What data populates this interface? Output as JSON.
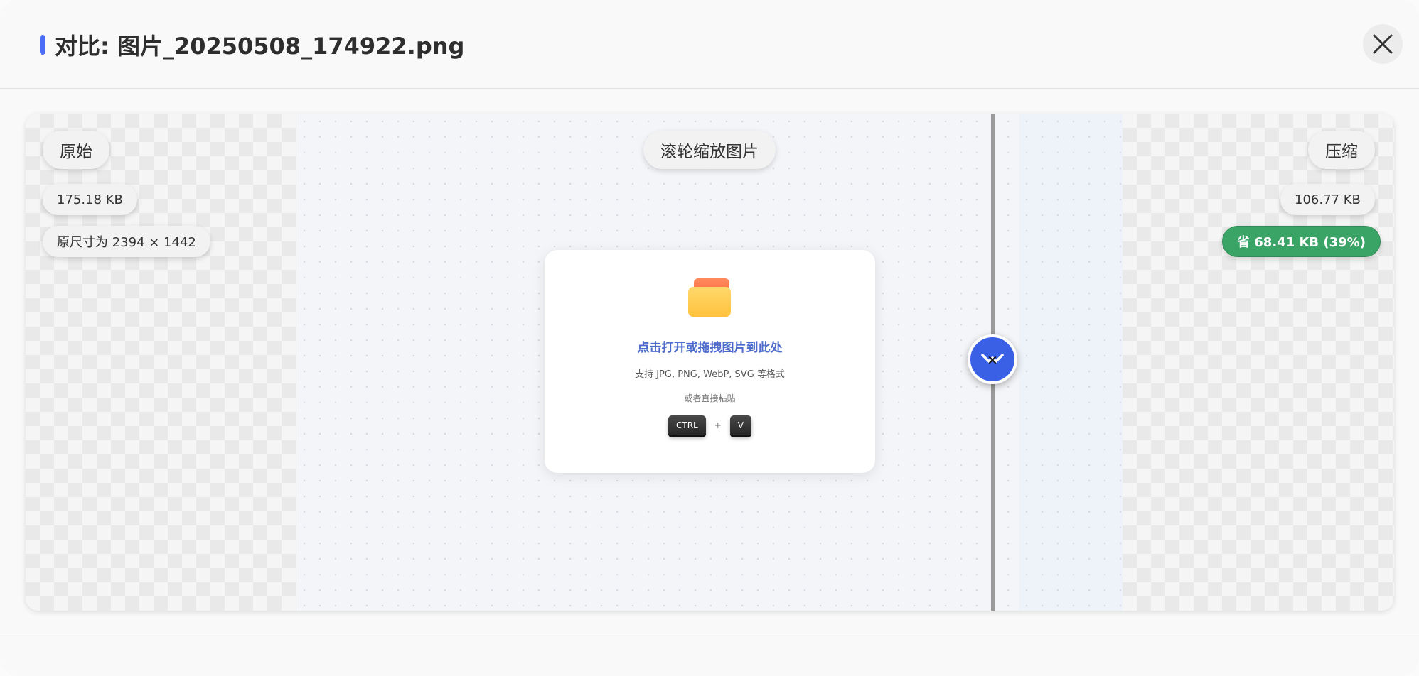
{
  "header": {
    "title": "对比: 图片_20250508_174922.png",
    "accent_color": "#4a6cf7",
    "close_icon": "close-icon"
  },
  "original": {
    "label": "原始",
    "size": "175.18 KB",
    "dimensions": "原尺寸为 2394 × 1442"
  },
  "center": {
    "zoom_hint": "滚轮缩放图片"
  },
  "compressed": {
    "label": "压缩",
    "size": "106.77 KB",
    "savings": "省 68.41 KB (39%)",
    "savings_color": "#3aa366"
  },
  "drop_zone": {
    "icon": "folder-icon",
    "title": "点击打开或拖拽图片到此处",
    "formats": "支持 JPG, PNG, WebP, SVG 等格式",
    "or_paste": "或者直接粘贴",
    "key_ctrl": "CTRL",
    "key_plus": "+",
    "key_v": "V"
  },
  "slider": {
    "handle_icon": "compare-handle-icon",
    "handle_color": "#3a60e6"
  }
}
